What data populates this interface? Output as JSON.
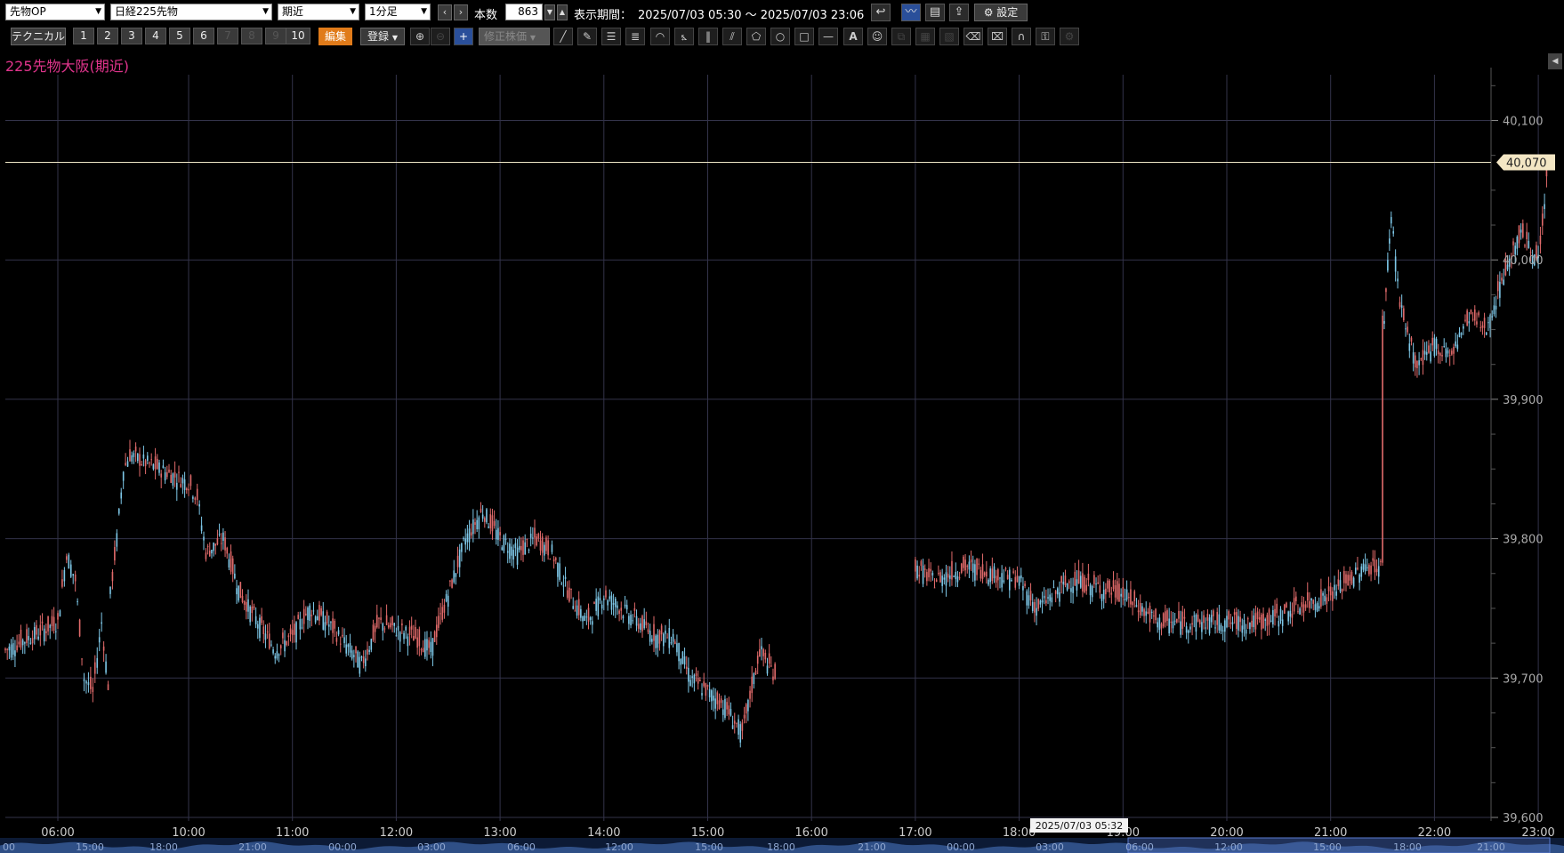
{
  "toolbar": {
    "market_select": "先物OP",
    "symbol_select": "日経225先物",
    "contract_select": "期近",
    "interval_select": "1分足",
    "bars_label": "本数",
    "bars_value": "863",
    "period_label": "表示期間：",
    "period_value": "2025/07/03 05:30 ～ 2025/07/03 23:06",
    "settings_label": "設定"
  },
  "toolbar2": {
    "technical_label": "テクニカル",
    "numbers": [
      "1",
      "2",
      "3",
      "4",
      "5",
      "6",
      "7",
      "8",
      "9",
      "10"
    ],
    "edit_label": "編集",
    "register_label": "登録",
    "adjusted_price_label": "修正株価"
  },
  "chart": {
    "title": "225先物大阪(期近)",
    "current_price_label": "40,070",
    "cursor_time_label": "2025/07/03 05:32"
  },
  "chart_data": {
    "type": "candlestick",
    "title": "225先物大阪(期近)",
    "ylim": [
      39600,
      40100
    ],
    "y_ticks": [
      "39,600",
      "39,700",
      "39,800",
      "39,900",
      "40,000",
      "40,100"
    ],
    "x_ticks": [
      "06:00",
      "10:00",
      "11:00",
      "12:00",
      "13:00",
      "14:00",
      "15:00",
      "16:00",
      "17:00",
      "18:00",
      "19:00",
      "20:00",
      "21:00",
      "22:00",
      "23:00"
    ],
    "current_price": 40070,
    "navigator_ticks": [
      "00",
      "15:00",
      "18:00",
      "21:00",
      "00:00",
      "03:00",
      "06:00",
      "12:00",
      "15:00",
      "18:00",
      "21:00",
      "00:00",
      "03:00",
      "06:00",
      "12:00",
      "15:00",
      "18:00",
      "21:00"
    ],
    "approx_path": [
      [
        "05:30",
        39720
      ],
      [
        "06:00",
        39740
      ],
      [
        "06:05",
        39790
      ],
      [
        "06:10",
        39770
      ],
      [
        "06:15",
        39700
      ],
      [
        "06:20",
        39690
      ],
      [
        "06:25",
        39740
      ],
      [
        "06:30",
        39680
      ],
      [
        "06:40",
        39720
      ],
      [
        "09:00",
        39760
      ],
      [
        "09:05",
        39800
      ],
      [
        "09:10",
        39850
      ],
      [
        "09:15",
        39860
      ],
      [
        "10:00",
        39840
      ],
      [
        "10:05",
        39830
      ],
      [
        "10:10",
        39790
      ],
      [
        "10:20",
        39800
      ],
      [
        "10:30",
        39760
      ],
      [
        "10:40",
        39740
      ],
      [
        "10:50",
        39720
      ],
      [
        "11:00",
        39730
      ],
      [
        "11:10",
        39750
      ],
      [
        "11:20",
        39740
      ],
      [
        "11:40",
        39710
      ],
      [
        "11:50",
        39740
      ],
      [
        "12:10",
        39730
      ],
      [
        "12:20",
        39720
      ],
      [
        "12:30",
        39760
      ],
      [
        "12:40",
        39800
      ],
      [
        "12:50",
        39820
      ],
      [
        "13:00",
        39800
      ],
      [
        "13:10",
        39790
      ],
      [
        "13:20",
        39800
      ],
      [
        "13:30",
        39790
      ],
      [
        "13:40",
        39760
      ],
      [
        "13:50",
        39740
      ],
      [
        "14:00",
        39760
      ],
      [
        "14:10",
        39750
      ],
      [
        "14:20",
        39740
      ],
      [
        "14:30",
        39730
      ],
      [
        "14:40",
        39730
      ],
      [
        "14:50",
        39700
      ],
      [
        "15:00",
        39690
      ],
      [
        "15:10",
        39680
      ],
      [
        "15:20",
        39660
      ],
      [
        "15:30",
        39720
      ],
      [
        "15:40",
        39700
      ],
      [
        "17:00",
        39780
      ],
      [
        "17:10",
        39770
      ],
      [
        "17:30",
        39780
      ],
      [
        "18:00",
        39770
      ],
      [
        "18:10",
        39750
      ],
      [
        "18:30",
        39770
      ],
      [
        "19:00",
        39760
      ],
      [
        "19:20",
        39740
      ],
      [
        "19:40",
        39740
      ],
      [
        "20:00",
        39740
      ],
      [
        "20:20",
        39740
      ],
      [
        "20:40",
        39750
      ],
      [
        "21:00",
        39760
      ],
      [
        "21:20",
        39780
      ],
      [
        "21:30",
        39780
      ],
      [
        "21:31",
        39960
      ],
      [
        "21:35",
        40030
      ],
      [
        "21:40",
        39970
      ],
      [
        "21:50",
        39920
      ],
      [
        "22:00",
        39940
      ],
      [
        "22:10",
        39930
      ],
      [
        "22:20",
        39960
      ],
      [
        "22:30",
        39950
      ],
      [
        "22:40",
        39990
      ],
      [
        "22:50",
        40020
      ],
      [
        "23:00",
        40000
      ],
      [
        "23:06",
        40070
      ]
    ]
  },
  "colors": {
    "up": "#e06a6a",
    "down": "#7ec8e8",
    "grid": "#33334a",
    "title": "#e0348c",
    "edit_button": "#e07b1a"
  }
}
